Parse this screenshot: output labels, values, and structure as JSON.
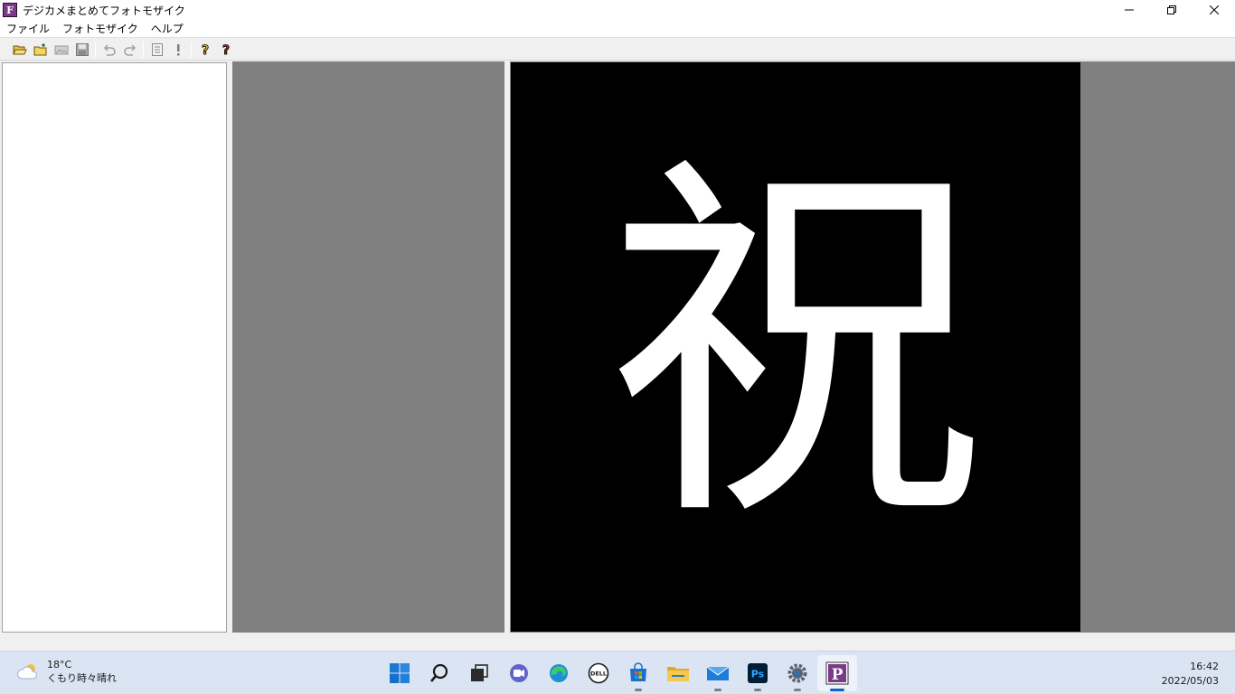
{
  "window": {
    "icon_letter": "F",
    "title": "デジカメまとめてフォトモザイク"
  },
  "menu": {
    "items": [
      {
        "label": "ファイル"
      },
      {
        "label": "フォトモザイク"
      },
      {
        "label": "ヘルプ"
      }
    ]
  },
  "toolbar": {
    "buttons": [
      "open-folder-icon",
      "new-folder-icon",
      "image-icon",
      "save-icon",
      "undo-icon",
      "redo-icon",
      "list-icon",
      "exclamation-icon",
      "help-icon",
      "context-help-icon"
    ]
  },
  "image": {
    "character": "祝",
    "background": "#000000",
    "foreground": "#ffffff"
  },
  "taskbar": {
    "weather": {
      "temperature": "18°C",
      "condition": "くもり時々晴れ"
    },
    "apps": [
      "start",
      "search",
      "task-view",
      "teams",
      "edge",
      "dell",
      "store",
      "file-explorer",
      "mail",
      "photoshop",
      "settings",
      "photomosaic"
    ],
    "clock": {
      "time": "16:42",
      "date": "2022/05/03"
    }
  },
  "colors": {
    "panel_gray": "#808080",
    "taskbar": "#dbe4f3",
    "accent": "#1262c7"
  }
}
